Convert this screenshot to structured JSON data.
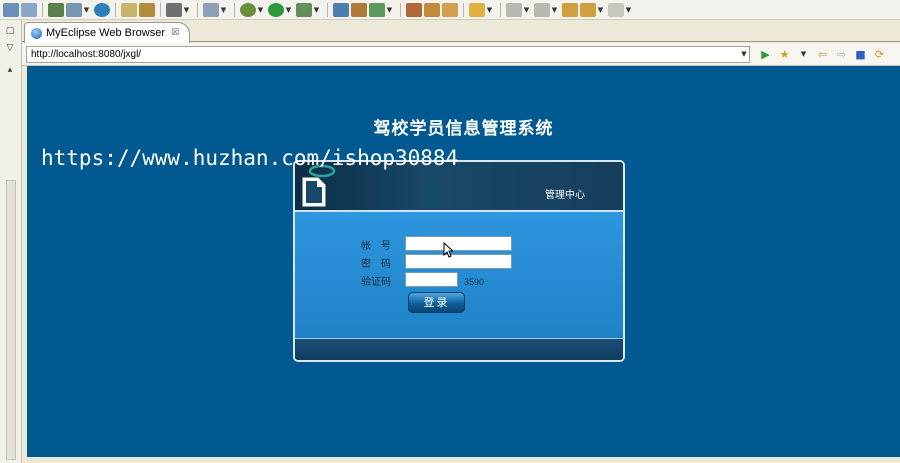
{
  "tab": {
    "title": "MyEclipse Web Browser",
    "close": "☒"
  },
  "address": {
    "url": "http://localhost:8080/jxgl/"
  },
  "page": {
    "title": "驾校学员信息管理系统",
    "watermark": "https://www.huzhan.com/ishop30884"
  },
  "login": {
    "header_name": "管理中心",
    "account_label": "帐　号",
    "password_label": "密　码",
    "captcha_label": "验证码",
    "captcha_value": "3590",
    "button_label": "登录"
  },
  "colors": {
    "page_bg": "#005990",
    "panel_body": "#2d96de",
    "panel_header": "#0b2d48"
  },
  "icons": {
    "run": "run-icon",
    "favorite": "star-icon",
    "back": "back-arrow-icon",
    "forward": "forward-arrow-icon",
    "stop": "stop-icon",
    "refresh": "refresh-icon"
  }
}
